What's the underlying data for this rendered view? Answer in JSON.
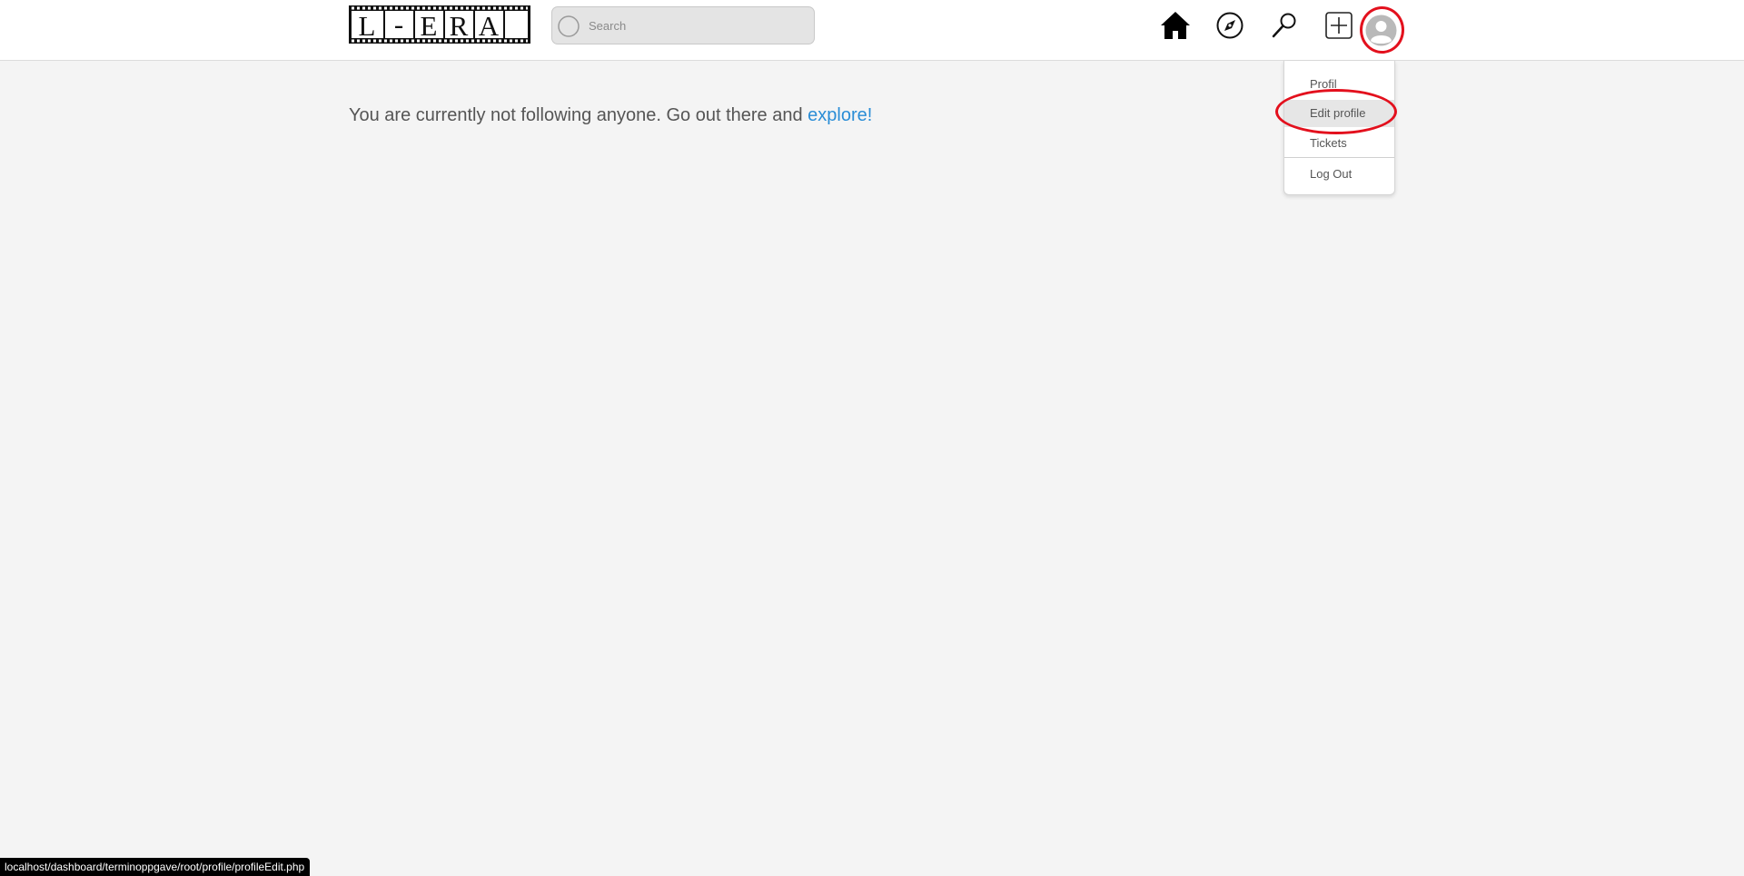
{
  "header": {
    "logo_text": "L-ERA",
    "search": {
      "placeholder": "Search",
      "value": ""
    },
    "nav_icons": [
      "home-icon",
      "compass-icon",
      "magnifier-icon",
      "plus-square-icon",
      "avatar-icon"
    ]
  },
  "dropdown": {
    "items": [
      {
        "label": "Profil"
      },
      {
        "label": "Edit profile"
      },
      {
        "label": "Tickets"
      },
      {
        "label": "Log Out"
      }
    ]
  },
  "main": {
    "message_prefix": "You are currently not following anyone. Go out there and ",
    "explore_link": "explore!"
  },
  "status_bar": {
    "url": "localhost/dashboard/terminoppgave/root/profile/profileEdit.php"
  },
  "colors": {
    "page_background": "#f4f4f4",
    "header_background": "#ffffff",
    "link": "#2a8dd6",
    "annotation_red": "#e3101d",
    "selected_item_bg": "#e6e6e6"
  }
}
